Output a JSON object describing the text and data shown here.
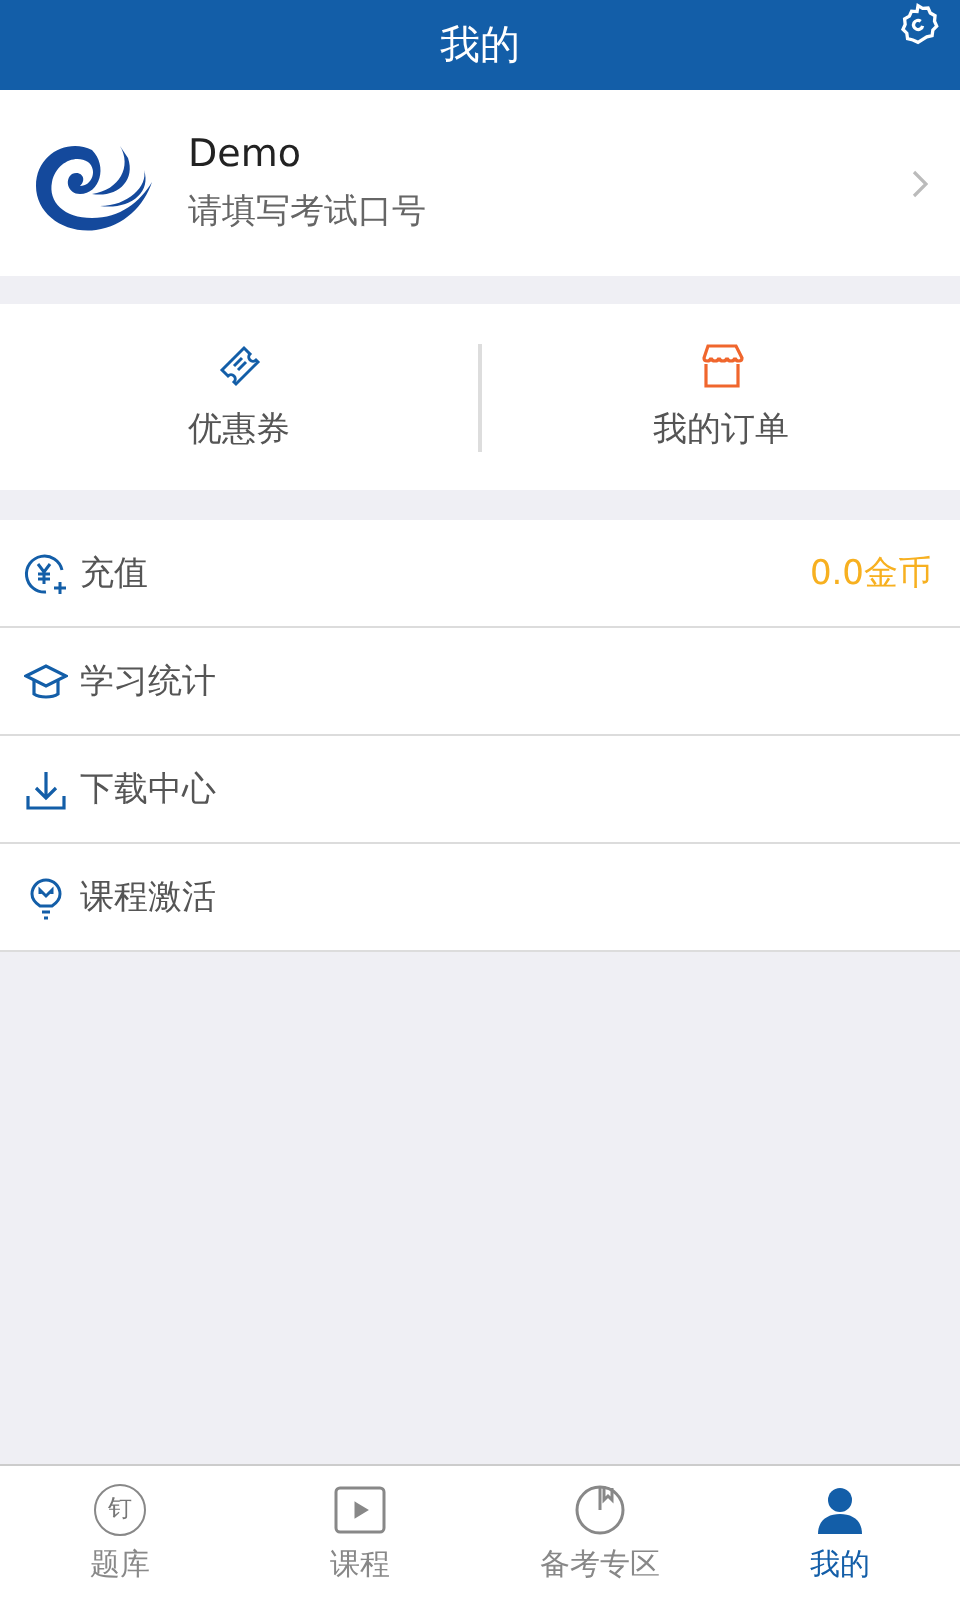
{
  "header": {
    "title": "我的"
  },
  "profile": {
    "name": "Demo",
    "subtitle": "请填写考试口号"
  },
  "shortcuts": [
    {
      "kind": "coupon",
      "label": "优惠券"
    },
    {
      "kind": "store",
      "label": "我的订单"
    }
  ],
  "menu": [
    {
      "kind": "recharge",
      "label": "充值",
      "value": "0.0金币"
    },
    {
      "kind": "study",
      "label": "学习统计"
    },
    {
      "kind": "download",
      "label": "下载中心"
    },
    {
      "kind": "activate",
      "label": "课程激活"
    }
  ],
  "tabs": [
    {
      "kind": "bank",
      "glyph": "钉",
      "label": "题库",
      "selected": false
    },
    {
      "kind": "course",
      "label": "课程",
      "selected": false
    },
    {
      "kind": "exam",
      "label": "备考专区",
      "selected": false
    },
    {
      "kind": "me",
      "label": "我的",
      "selected": true
    }
  ]
}
